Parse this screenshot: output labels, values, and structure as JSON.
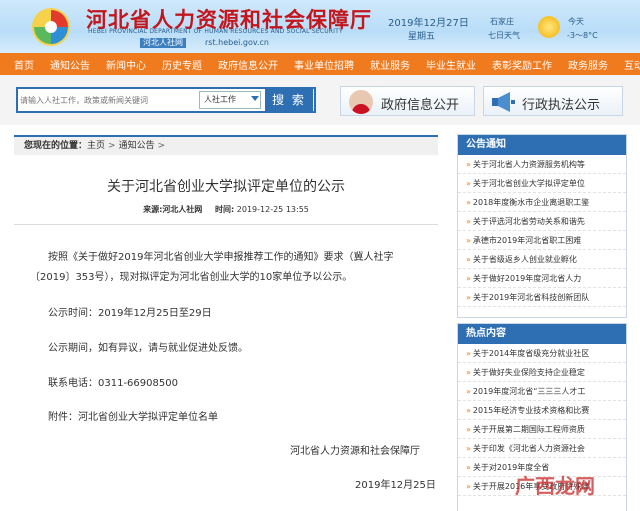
{
  "header": {
    "site_title": "河北省人力资源和社会保障厅",
    "site_subtitle": "HEBEI PROVINCIAL DEPARTMENT OF HUMAN RESOURCES AND SOCIAL SECURITY",
    "brand_small": "河北人社网",
    "domain": "rst.hebei.gov.cn",
    "date": "2019年12月27日",
    "weekday": "星期五",
    "city": "石家庄",
    "seven_day": "七日天气",
    "today": "今天",
    "temperature": "-3～8°C"
  },
  "nav": [
    "首页",
    "通知公告",
    "新闻中心",
    "历史专题",
    "政府信息公开",
    "事业单位招聘",
    "就业服务",
    "毕业生就业",
    "表彰奖励工作",
    "政务服务",
    "互动交流"
  ],
  "search": {
    "placeholder": "请输入人社工作，政策或新闻关键词",
    "scope": "人社工作",
    "button": "搜 索"
  },
  "quick_links": {
    "gov_info": "政府信息公开",
    "law_enforcement": "行政执法公示"
  },
  "breadcrumb": {
    "label": "您现在的位置：",
    "home": "主页",
    "sep": ">",
    "section": "通知公告",
    "tail": ">"
  },
  "article": {
    "title": "关于河北省创业大学拟评定单位的公示",
    "source_label": "来源:",
    "source": "河北人社网",
    "time_label": "时间:",
    "time": "2019-12-25  13:55",
    "para1": "按照《关于做好2019年河北省创业大学申报推荐工作的通知》要求（冀人社字〔2019〕353号），现对拟评定为河北省创业大学的10家单位予以公示。",
    "publicity_time": "公示时间：2019年12月25日至29日",
    "publicity_period": "公示期间，如有异议，请与就业促进处反馈。",
    "phone": "联系电话：0311-66908500",
    "attachment": "附件：河北省创业大学拟评定单位名单",
    "org": "河北省人力资源和社会保障厅",
    "sign_date": "2019年12月25日"
  },
  "sidebar": {
    "notices_title": "公告通知",
    "notices": [
      "关于河北省人力资源服务机构等",
      "关于河北省创业大学拟评定单位",
      "2018年度衡水市企业离退职工鉴",
      "关于评选河北省劳动关系和谐先",
      "承德市2019年河北省职工困难",
      "关于省级返乡人创业就业孵化",
      "关于做好2019年度河北省人力",
      "关于2019年河北省科技创新团队"
    ],
    "hot_title": "热点内容",
    "hot": [
      "关于2014年度省级充分就业社区",
      "关于做好失业保险支持企业稳定",
      "2019年度河北省“三三三人才工",
      "2015年经济专业技术资格和比赛",
      "关于开展第二期国际工程师资质",
      "关于印发《河北省人力资源社会",
      "关于对2019年度全省",
      "关于开展2016年享受政府特殊津"
    ]
  },
  "watermark": "广西龙网"
}
